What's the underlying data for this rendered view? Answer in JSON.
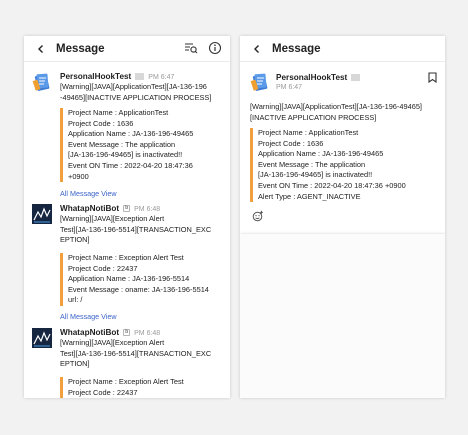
{
  "left": {
    "header": {
      "title": "Message",
      "back_icon": "chevron-left-icon",
      "list_search_icon": "list-search-icon",
      "info_icon": "info-icon"
    },
    "messages": [
      {
        "sender": "PersonalHookTest",
        "time": "PM 6:47",
        "subject": [
          "[Warning][JAVA][ApplicationTest][JA-136-196",
          "-49465][INACTIVE APPLICATION PROCESS]"
        ],
        "body": [
          "Project Name : ApplicationTest",
          "Project Code : 1636",
          "Application Name : JA-136-196-49465",
          "Event Message : The application",
          "[JA-136-196-49465] is inactivated!!",
          "Event ON Time : 2022-04-20 18:47:36",
          "+0900"
        ],
        "view_all": "All Message View"
      },
      {
        "sender": "WhatapNotiBot",
        "time": "PM 6:48",
        "subject": [
          "[Warning][JAVA][Exception Alert",
          "Test][JA-136-196-5514][TRANSACTION_EXC",
          "EPTION]"
        ],
        "body": [
          "Project Name : Exception Alert Test",
          "Project Code : 22437",
          "Application Name : JA-136-196-5514",
          "Event Message : oname: JA-136-196-5514",
          "url: /"
        ],
        "view_all": "All Message View"
      },
      {
        "sender": "WhatapNotiBot",
        "time": "PM 6:48",
        "subject": [
          "[Warning][JAVA][Exception Alert",
          "Test][JA-136-196-5514][TRANSACTION_EXC",
          "EPTION]"
        ],
        "body": [
          "Project Name : Exception Alert Test",
          "Project Code : 22437"
        ]
      }
    ]
  },
  "right": {
    "header": {
      "title": "Message",
      "back_icon": "chevron-left-icon"
    },
    "sender": "PersonalHookTest",
    "time": "PM 6:47",
    "bookmark_icon": "bookmark-icon",
    "subject": [
      "[Warning][JAVA][ApplicationTest][JA-136-196-49465]",
      "[INACTIVE APPLICATION PROCESS]"
    ],
    "body": [
      "Project Name : ApplicationTest",
      "Project Code : 1636",
      "Application Name : JA-136-196-49465",
      "Event Message : The application",
      "[JA-136-196-49465] is inactivated!!",
      "Event ON Time : 2022-04-20 18:47:36 +0900",
      "Alert Type : AGENT_INACTIVE"
    ],
    "reaction_icon": "add-reaction-icon"
  },
  "colors": {
    "accent_bar": "#f2a03d",
    "link": "#3a63c9",
    "meta": "#9a9a9a"
  }
}
